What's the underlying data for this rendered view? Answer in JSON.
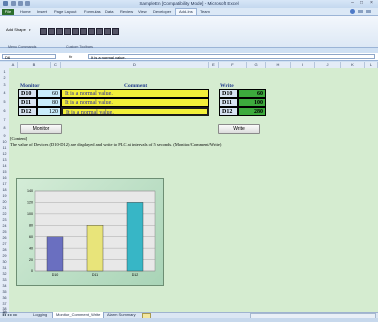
{
  "window": {
    "title": "SampleEn [Compatibility Mode] - Microsoft Excel"
  },
  "ribbon": {
    "tabs": [
      "File",
      "Home",
      "Insert",
      "Page Layout",
      "Formulas",
      "Data",
      "Review",
      "View",
      "Developer",
      "Add-Ins",
      "Team"
    ],
    "active_tab": "Add-Ins",
    "add_shape_label": "Add Shape",
    "groups": [
      "Menu Commands",
      "Custom Toolbars"
    ]
  },
  "formula_bar": {
    "name_box": "D6",
    "fx": "fx",
    "formula": "It is a normal value."
  },
  "columns": [
    "A",
    "B",
    "C",
    "D",
    "E",
    "F",
    "G",
    "H",
    "I",
    "J",
    "K",
    "L"
  ],
  "rows": [
    "1",
    "2",
    "3",
    "4",
    "5",
    "6",
    "7",
    "8",
    "9",
    "10",
    "11",
    "12",
    "13",
    "14",
    "15",
    "16",
    "17",
    "18",
    "19",
    "20",
    "21",
    "22",
    "23",
    "24",
    "25",
    "26",
    "27",
    "28",
    "29",
    "30",
    "31",
    "32",
    "33",
    "34",
    "35",
    "36",
    "37",
    "38",
    "39",
    "40"
  ],
  "monitor": {
    "header": "Monitor",
    "comment_header": "Comment",
    "rows": [
      {
        "device": "D10",
        "value": "60",
        "comment": "It is a normal value."
      },
      {
        "device": "D11",
        "value": "80",
        "comment": "It is a normal value."
      },
      {
        "device": "D12",
        "value": "120",
        "comment": "It is a normal value."
      }
    ]
  },
  "write": {
    "header": "Write",
    "rows": [
      {
        "device": "D10",
        "value": "60"
      },
      {
        "device": "D11",
        "value": "100"
      },
      {
        "device": "D12",
        "value": "280"
      }
    ]
  },
  "buttons": {
    "monitor": "Monitor",
    "write": "Write"
  },
  "content": {
    "label": "[Content]",
    "text": "The value of Devices (D10-D12) are displayed and write to PLC at intervals of 5 seconds. (Monitor/Comment/Write)"
  },
  "chart_data": {
    "type": "bar",
    "categories": [
      "D10",
      "D11",
      "D12"
    ],
    "values": [
      60,
      80,
      120
    ],
    "ylim": [
      0,
      140
    ],
    "yticks": [
      0,
      20,
      40,
      60,
      80,
      100,
      120,
      140
    ],
    "colors": [
      "#6a6fc0",
      "#e8e47a",
      "#37b6c6"
    ],
    "grid": true
  },
  "sheet_tabs": [
    "Logging",
    "Monitor_Comment_Write",
    "Alarm Summary"
  ],
  "active_sheet": "Monitor_Comment_Write"
}
